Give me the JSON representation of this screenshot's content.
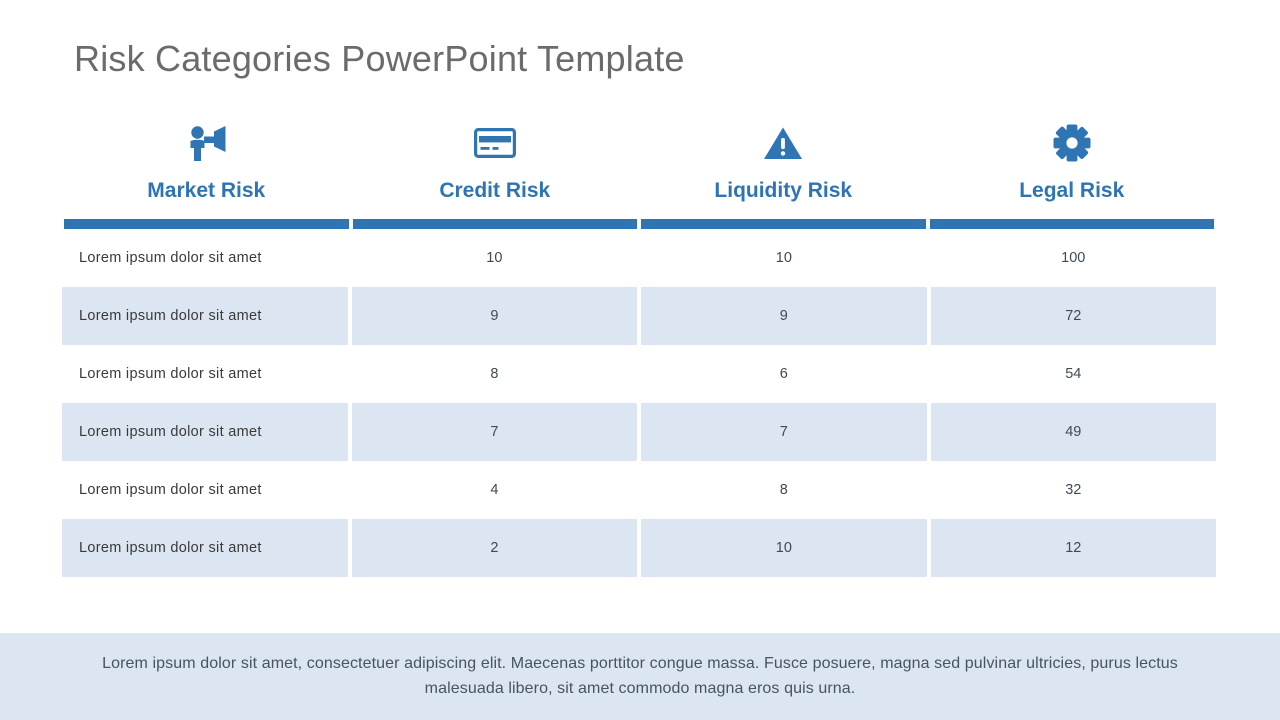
{
  "slide": {
    "title": "Risk Categories PowerPoint Template",
    "title_color": "#6b6b6b",
    "accent_color": "#2e74b5",
    "bar_color": "#2f74b3",
    "alt_row_color": "#dce6f2",
    "footer_band_color": "#dce6f2"
  },
  "table": {
    "columns": [
      {
        "label": "Market Risk",
        "icon": "person-megaphone-icon"
      },
      {
        "label": "Credit Risk",
        "icon": "credit-card-icon"
      },
      {
        "label": "Liquidity Risk",
        "icon": "warning-triangle-icon"
      },
      {
        "label": "Legal Risk",
        "icon": "gear-icon"
      }
    ],
    "rows": [
      {
        "label": "Lorem ipsum dolor sit amet",
        "credit": "10",
        "liquidity": "10",
        "legal": "100"
      },
      {
        "label": "Lorem ipsum dolor sit amet",
        "credit": "9",
        "liquidity": "9",
        "legal": "72"
      },
      {
        "label": "Lorem ipsum dolor sit amet",
        "credit": "8",
        "liquidity": "6",
        "legal": "54"
      },
      {
        "label": "Lorem ipsum dolor sit amet",
        "credit": "7",
        "liquidity": "7",
        "legal": "49"
      },
      {
        "label": "Lorem ipsum dolor sit amet",
        "credit": "4",
        "liquidity": "8",
        "legal": "32"
      },
      {
        "label": "Lorem ipsum dolor sit amet",
        "credit": "2",
        "liquidity": "10",
        "legal": "12"
      }
    ]
  },
  "footer": {
    "text": "Lorem ipsum dolor sit amet, consectetuer adipiscing elit. Maecenas porttitor congue massa. Fusce posuere, magna sed pulvinar ultricies, purus lectus malesuada libero, sit amet commodo magna eros quis urna."
  }
}
